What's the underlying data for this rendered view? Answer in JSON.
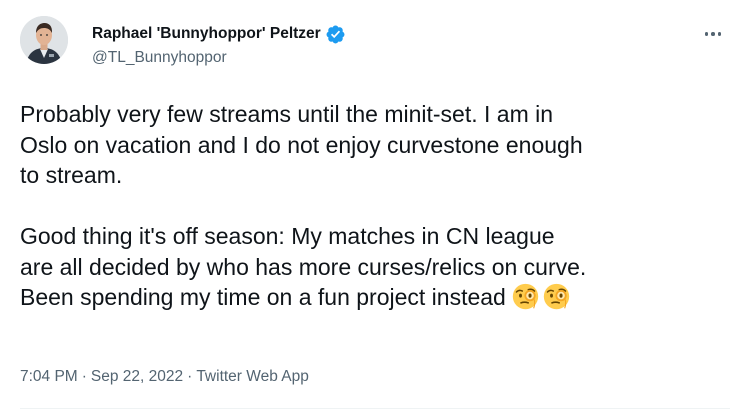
{
  "tweet": {
    "author": {
      "display_name": "Raphael 'Bunnyhoppor' Peltzer",
      "handle": "@TL_Bunnyhoppor",
      "verified_icon": "verified-badge-icon"
    },
    "more_icon": "more-options-icon",
    "text": {
      "paragraph1": [
        "Probably very few streams until the minit-set. I am in",
        "Oslo on vacation and I do not enjoy curvestone enough",
        "to stream."
      ],
      "paragraph2": [
        "Good thing it's off season: My matches in CN league",
        "are all decided by who has more curses/relics on curve.",
        "Been spending my time on a fun project instead"
      ],
      "emoji": [
        "face-with-monocle-emoji",
        "face-with-monocle-emoji"
      ]
    },
    "meta": {
      "time": "7:04 PM",
      "separator": "·",
      "date": "Sep 22, 2022",
      "source": "Twitter Web App"
    },
    "colors": {
      "text": "#0f1419",
      "secondary": "#536471",
      "verified": "#1d9bf0",
      "divider": "#eff3f4"
    }
  }
}
